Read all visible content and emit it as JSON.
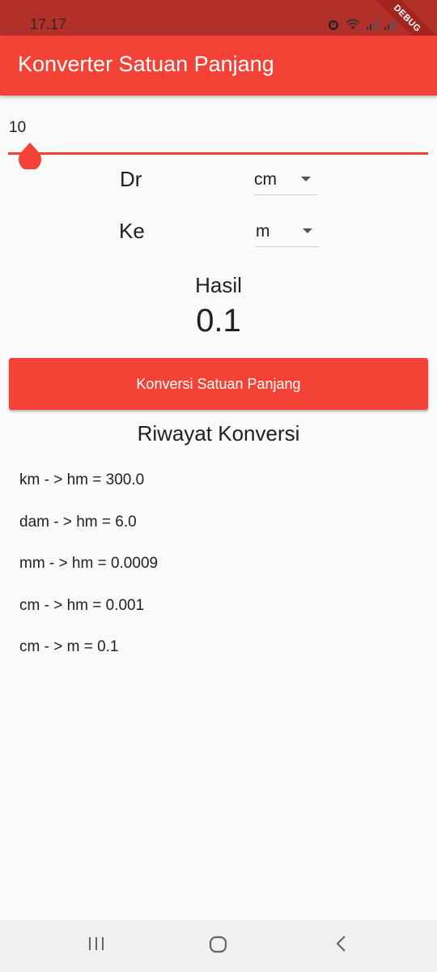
{
  "status_bar": {
    "time": "17.17",
    "debug_label": "DEBUG"
  },
  "app_bar": {
    "title": "Konverter Satuan Panjang",
    "color": "#f44336"
  },
  "slider": {
    "value_label": "10",
    "value": 10
  },
  "from": {
    "label": "Dr",
    "selected": "cm"
  },
  "to": {
    "label": "Ke",
    "selected": "m"
  },
  "result": {
    "label": "Hasil",
    "value": "0.1"
  },
  "convert_button": {
    "label": "Konversi Satuan Panjang"
  },
  "history": {
    "title": "Riwayat Konversi",
    "items": [
      "km - > hm = 300.0",
      "dam - > hm = 6.0",
      "mm - > hm = 0.0009",
      "cm - > hm = 0.001",
      "cm - > m = 0.1"
    ]
  },
  "nav": {
    "icons": [
      "recent-apps-icon",
      "home-icon",
      "back-icon"
    ]
  }
}
